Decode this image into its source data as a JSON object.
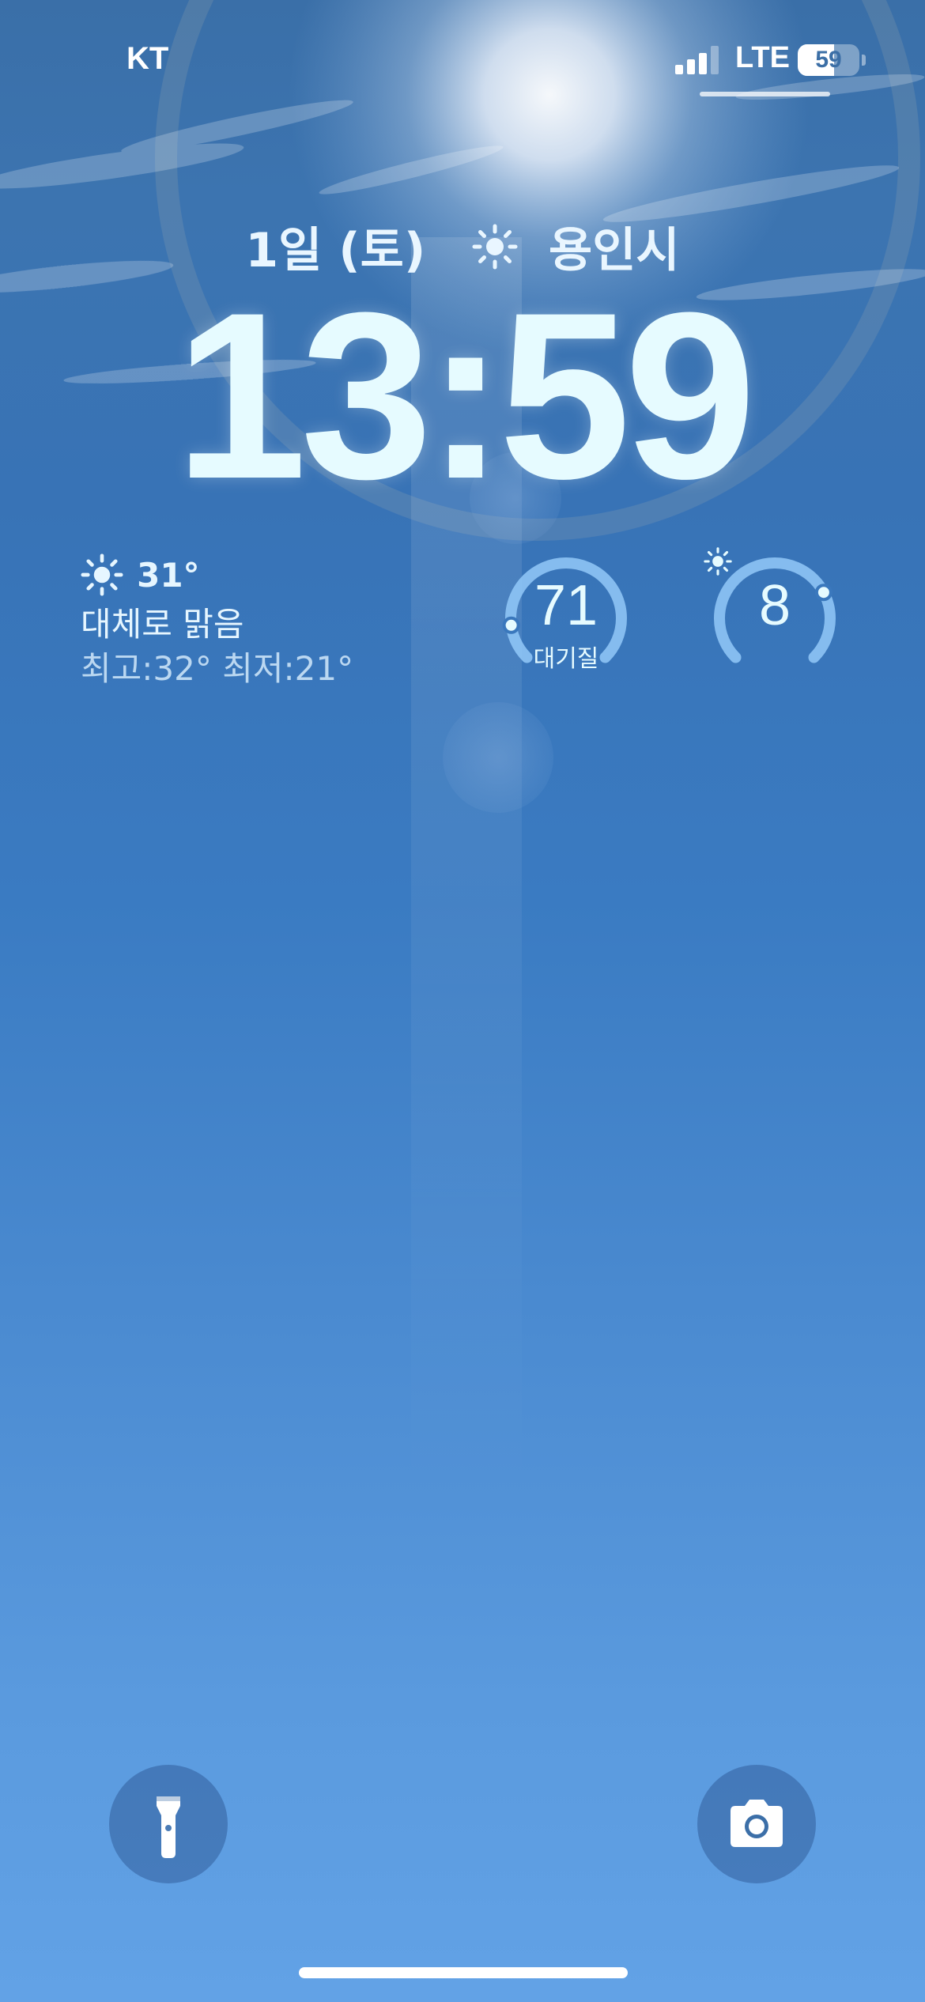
{
  "status_bar": {
    "carrier": "KT",
    "signal_bars_active": 3,
    "signal_bars_total": 4,
    "network": "LTE",
    "battery_level": "59",
    "battery_fraction": 0.59
  },
  "lock_screen": {
    "date_label": "1일 (토)",
    "date_weather_icon": "sun-icon",
    "location": "용인시",
    "time": "13:59"
  },
  "widgets": {
    "weather": {
      "icon": "sun-icon",
      "temperature": "31°",
      "condition": "대체로 맑음",
      "high_low": "최고:32° 최저:21°"
    },
    "air_quality": {
      "value": "71",
      "label": "대기질",
      "level_fraction": 0.14
    },
    "uv_index": {
      "value": "8",
      "icon": "sun-icon",
      "level_fraction": 0.73
    }
  },
  "quick_actions": {
    "left": {
      "icon": "flashlight-icon"
    },
    "right": {
      "icon": "camera-icon"
    }
  },
  "colors": {
    "sky_top": "#3a6fa8",
    "sky_bottom": "#62a2e6",
    "text_glow": "#e6fbff",
    "gauge_accent": "#8ec4f5"
  }
}
